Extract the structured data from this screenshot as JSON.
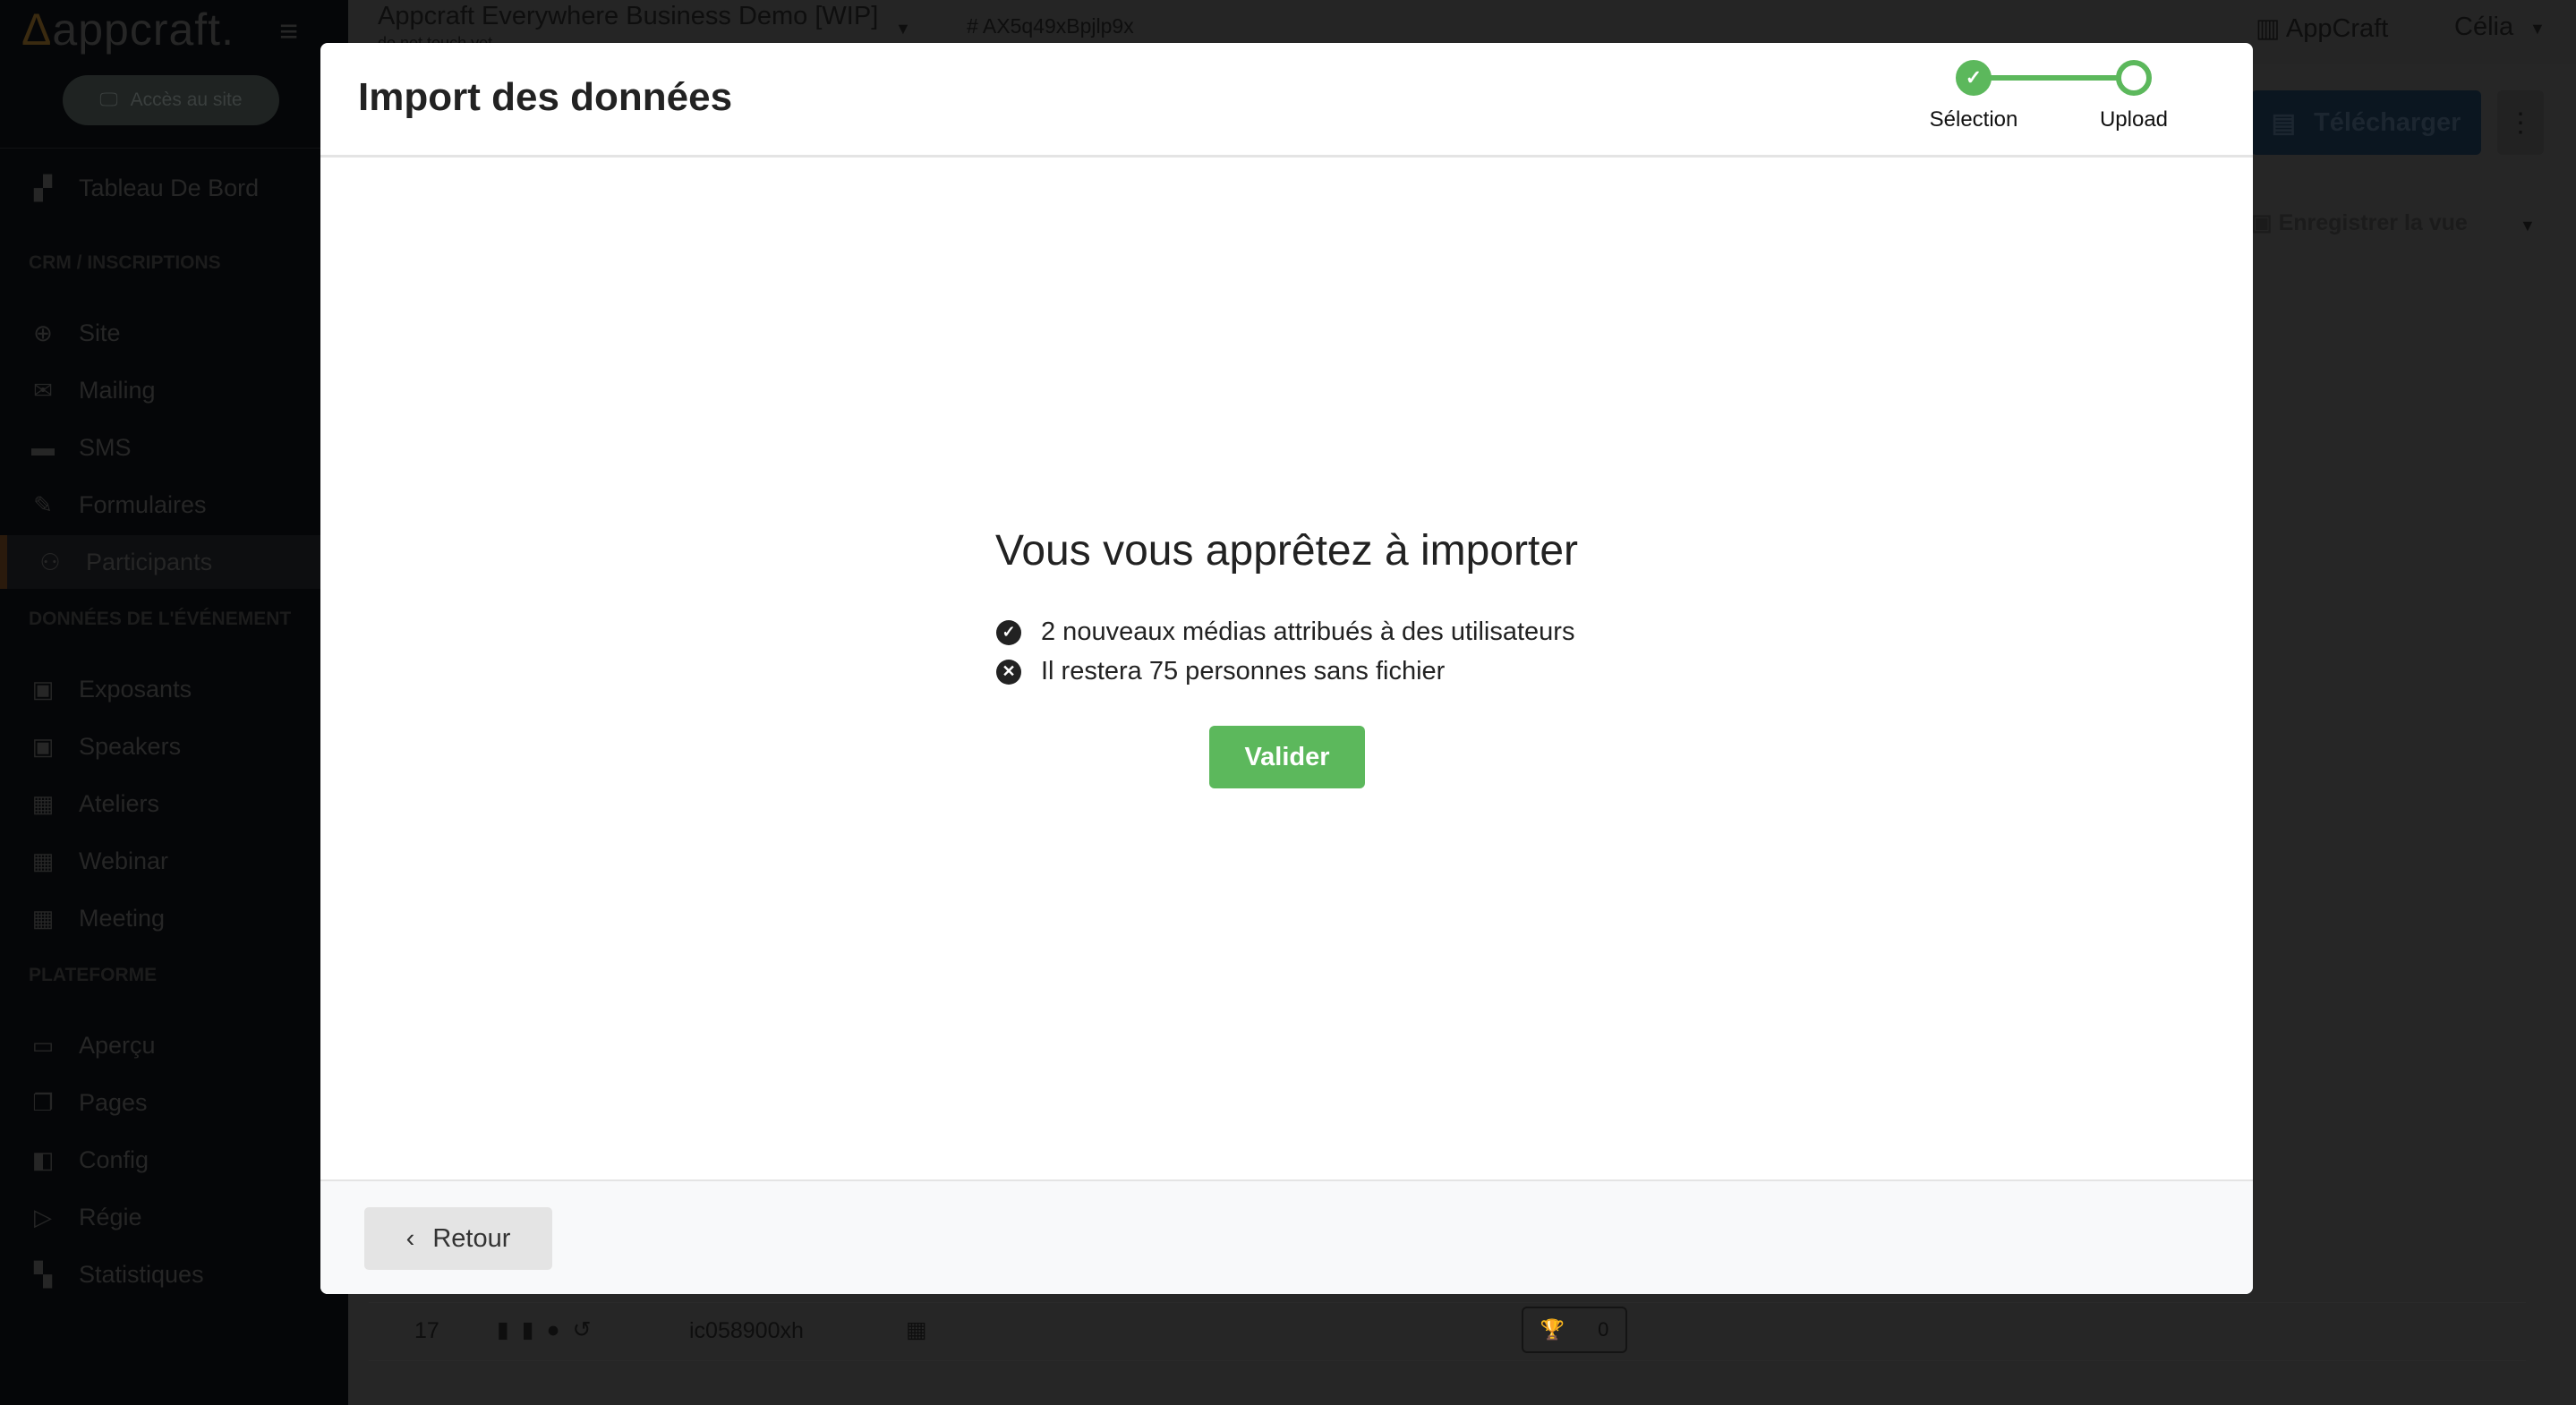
{
  "sidebar": {
    "logo": "appcraft.",
    "site_button": "Accès au site",
    "items": [
      {
        "label": "Tableau De Bord",
        "icon": "dashboard-icon",
        "type": "item"
      },
      {
        "label": "CRM / INSCRIPTIONS",
        "type": "header"
      },
      {
        "label": "Site",
        "icon": "globe-icon",
        "type": "item"
      },
      {
        "label": "Mailing",
        "icon": "envelope-icon",
        "type": "item"
      },
      {
        "label": "SMS",
        "icon": "message-icon",
        "type": "item"
      },
      {
        "label": "Formulaires",
        "icon": "pencil-icon",
        "type": "item"
      },
      {
        "label": "Participants",
        "icon": "users-icon",
        "type": "item",
        "active": true
      },
      {
        "label": "DONNÉES DE L'ÉVÉNEMENT",
        "type": "header"
      },
      {
        "label": "Exposants",
        "icon": "id-card-icon",
        "type": "item"
      },
      {
        "label": "Speakers",
        "icon": "id-card-icon",
        "type": "item"
      },
      {
        "label": "Ateliers",
        "icon": "calendar-icon",
        "type": "item"
      },
      {
        "label": "Webinar",
        "icon": "calendar-icon",
        "type": "item"
      },
      {
        "label": "Meeting",
        "icon": "calendar-icon",
        "type": "item"
      },
      {
        "label": "PLATEFORME",
        "type": "header"
      },
      {
        "label": "Aperçu",
        "icon": "laptop-icon",
        "type": "item"
      },
      {
        "label": "Pages",
        "icon": "pages-icon",
        "type": "item"
      },
      {
        "label": "Config",
        "icon": "config-icon",
        "type": "item"
      },
      {
        "label": "Régie",
        "icon": "video-settings-icon",
        "type": "item"
      },
      {
        "label": "Statistiques",
        "icon": "stats-icon",
        "type": "item"
      }
    ]
  },
  "topbar": {
    "project_title": "Appcraft Everywhere Business Demo [WIP]",
    "project_subtitle": "do not touch yet",
    "project_id": "# AX5q49xBpjlp9x",
    "organization": "AppCraft",
    "user": "Célia"
  },
  "toolbar": {
    "download_label": "Télécharger",
    "save_view_label": "Enregistrer la vue"
  },
  "table": {
    "row": {
      "index": "17",
      "id": "ic058900xh",
      "points": "0"
    }
  },
  "modal": {
    "title": "Import des données",
    "steps": [
      {
        "label": "Sélection",
        "done": true
      },
      {
        "label": "Upload",
        "done": false
      }
    ],
    "heading": "Vous vous apprêtez à importer",
    "items": [
      {
        "text": "2 nouveaux médias attribués à des utilisateurs",
        "icon": "check-circle-icon"
      },
      {
        "text": "Il restera 75 personnes sans fichier",
        "icon": "times-circle-icon"
      }
    ],
    "confirm_label": "Valider",
    "back_label": "Retour"
  },
  "colors": {
    "accent": "#5cb85c",
    "download_button": "#0b1620"
  }
}
